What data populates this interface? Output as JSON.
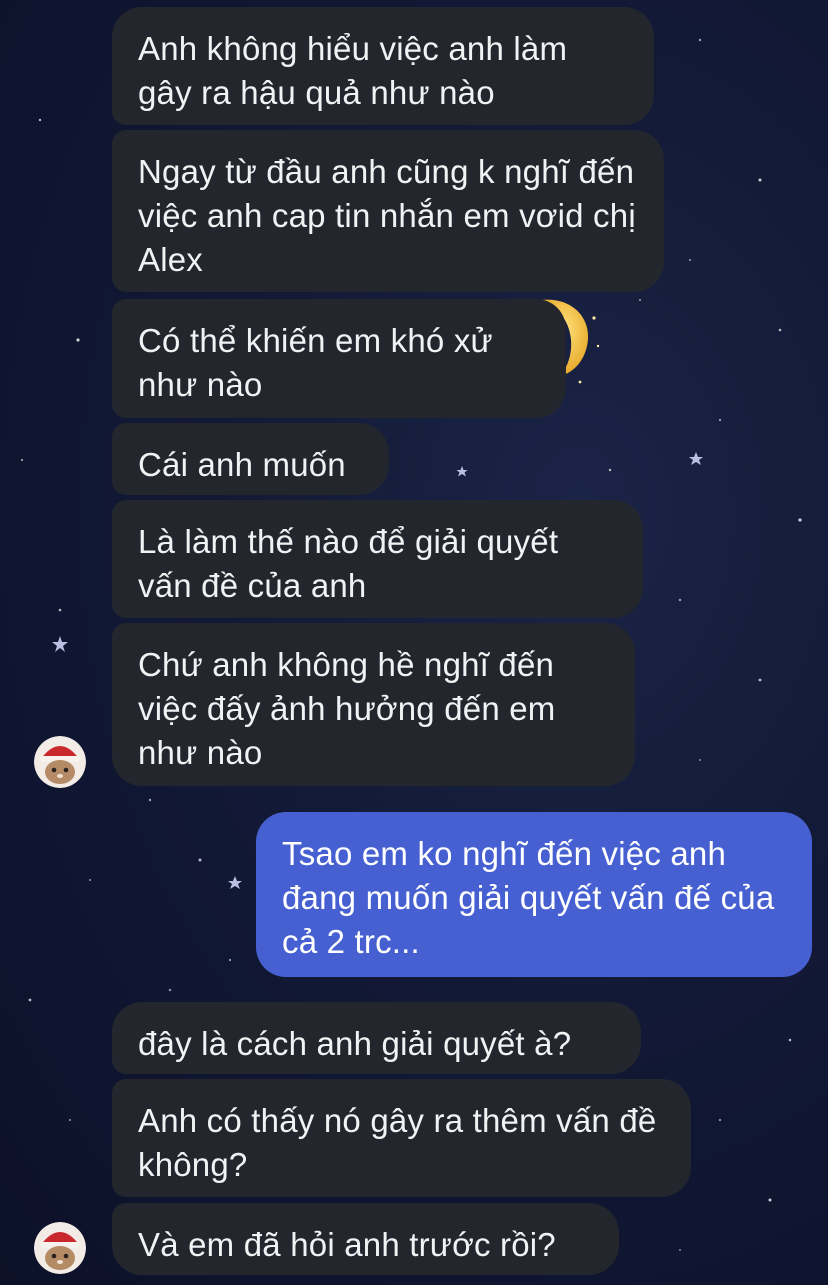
{
  "conversation": {
    "messages": [
      {
        "sender": "other",
        "text": "Anh không hiểu việc anh làm gây ra hậu quả như nào"
      },
      {
        "sender": "other",
        "text": "Ngay từ đầu anh cũng k nghĩ đến việc anh cap tin nhắn em vơid chị Alex"
      },
      {
        "sender": "other",
        "text": "Có thể khiến em khó xử như nào"
      },
      {
        "sender": "other",
        "text": "Cái anh muốn"
      },
      {
        "sender": "other",
        "text": "Là làm thế nào để giải quyết vấn đề của anh"
      },
      {
        "sender": "other",
        "text": "Chứ anh không hề nghĩ đến việc đấy ảnh hưởng đến em như nào"
      },
      {
        "sender": "me",
        "text": "Tsao em ko nghĩ đến việc anh đang muốn giải quyết vấn đế của cả 2 trc..."
      },
      {
        "sender": "other",
        "text": "đây là cách anh giải quyết à?"
      },
      {
        "sender": "other",
        "text": "Anh có thấy nó gây ra thêm vấn đề không?"
      },
      {
        "sender": "other",
        "text": "Và em đã hỏi anh trước rồi?"
      }
    ]
  },
  "colors": {
    "incoming_bubble": "#23272d",
    "outgoing_bubble": "#4660d2",
    "background": "#121936"
  },
  "icons": {
    "avatar": "cat-in-santa-hat-avatar",
    "background_decoration": "crescent-moon-icon"
  }
}
